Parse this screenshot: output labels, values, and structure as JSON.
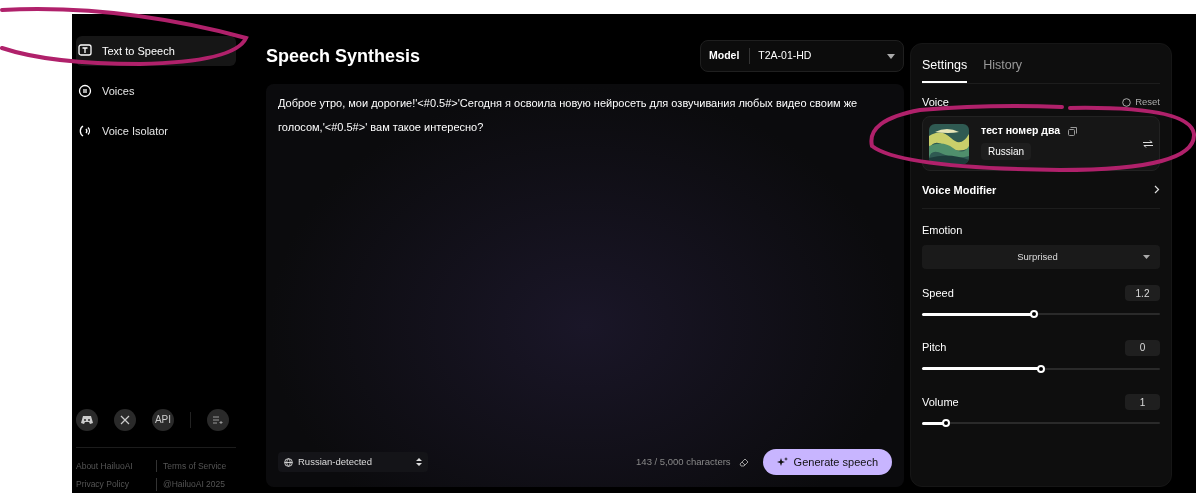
{
  "sidebar": {
    "items": [
      {
        "label": "Text to Speech",
        "kind": "text",
        "selected": true
      },
      {
        "label": "Voices",
        "kind": "voices",
        "selected": false
      },
      {
        "label": "Voice Isolator",
        "kind": "isolator",
        "selected": false
      }
    ],
    "social": [
      {
        "kind": "discord"
      },
      {
        "kind": "x"
      },
      {
        "kind": "text",
        "label": "API"
      }
    ],
    "footer_links": [
      "About HailuoAI",
      "Terms of Service",
      "Privacy Policy",
      "@HailuoAI 2025"
    ]
  },
  "main": {
    "title": "Speech Synthesis",
    "model": {
      "label": "Model",
      "value": "T2A-01-HD"
    },
    "text": "Доброе утро, мои дорогие!'<#0.5#>'Сегодня я освоила новую нейросеть для озвучивания любых видео своим же голосом,'<#0.5#>' вам такое интересно?",
    "language": "Russian-detected",
    "char_count": "143 / 5,000 characters",
    "generate": "Generate speech"
  },
  "settings": {
    "tabs": [
      {
        "label": "Settings",
        "selected": true
      },
      {
        "label": "History",
        "selected": false
      }
    ],
    "voice_label": "Voice",
    "reset": "Reset",
    "voice": {
      "name": "тест номер два",
      "language": "Russian"
    },
    "voice_modifier": "Voice Modifier",
    "emotion_label": "Emotion",
    "emotion": "Surprised",
    "sliders": [
      {
        "label": "Speed",
        "reading": "1.2",
        "level": 0.47
      },
      {
        "label": "Pitch",
        "reading": "0",
        "level": 0.5
      },
      {
        "label": "Volume",
        "reading": "1",
        "level": 0.1
      }
    ]
  }
}
